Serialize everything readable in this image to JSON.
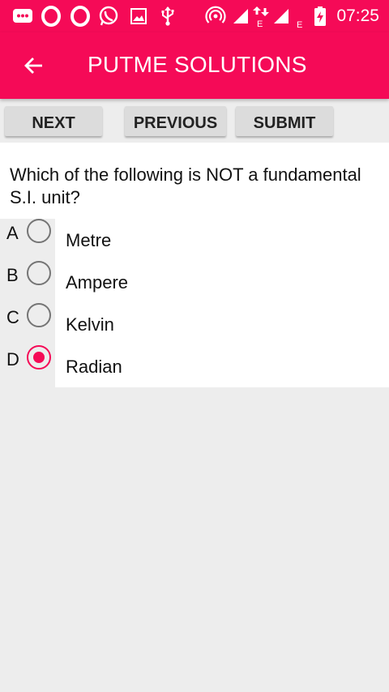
{
  "status_bar": {
    "time": "07:25",
    "network_badge_1": "E",
    "network_badge_2": "E",
    "icons": [
      "message-icon",
      "opera-icon",
      "opera-icon",
      "whatsapp-icon",
      "image-icon",
      "usb-icon",
      "hotspot-icon",
      "signal-icon",
      "data-transfer-icon",
      "signal-icon",
      "battery-charging-icon"
    ]
  },
  "app_bar": {
    "title": "PUTME SOLUTIONS",
    "back_icon": "arrow-back-icon"
  },
  "toolbar": {
    "next_label": "NEXT",
    "previous_label": "PREVIOUS",
    "submit_label": "SUBMIT"
  },
  "question": {
    "text": "Which of the following is NOT a fundamental S.I. unit?"
  },
  "options": [
    {
      "letter": "A",
      "text": "Metre",
      "selected": false
    },
    {
      "letter": "B",
      "text": "Ampere",
      "selected": false
    },
    {
      "letter": "C",
      "text": "Kelvin",
      "selected": false
    },
    {
      "letter": "D",
      "text": "Radian",
      "selected": true
    }
  ],
  "colors": {
    "accent": "#f50a57",
    "background": "#ededed",
    "button": "#dcdcdc"
  }
}
